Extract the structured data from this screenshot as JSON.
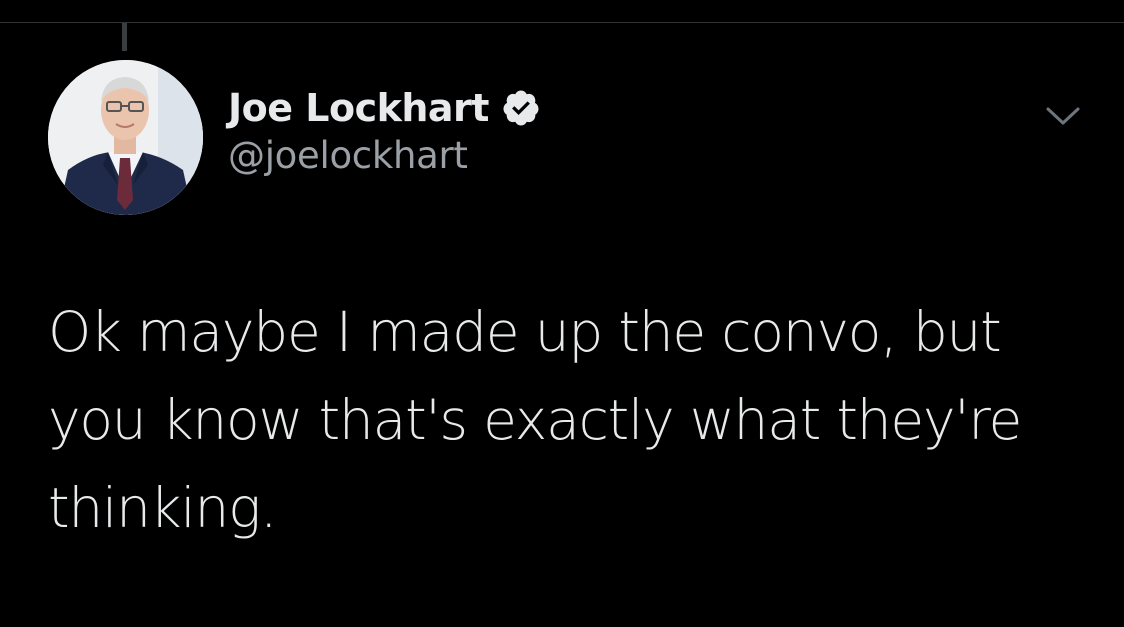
{
  "tweet": {
    "author": {
      "display_name": "Joe Lockhart",
      "handle": "@joelockhart",
      "verified": true,
      "avatar_icon": "profile-photo"
    },
    "text": "Ok maybe I made up the convo, but\nyou know that's exactly what they're\nthinking.",
    "menu_icon": "chevron-down-icon"
  },
  "colors": {
    "background": "#000000",
    "primary_text": "#e7e9ea",
    "secondary_text": "#9aa0a6",
    "verified_badge": "#e7e9ea"
  }
}
